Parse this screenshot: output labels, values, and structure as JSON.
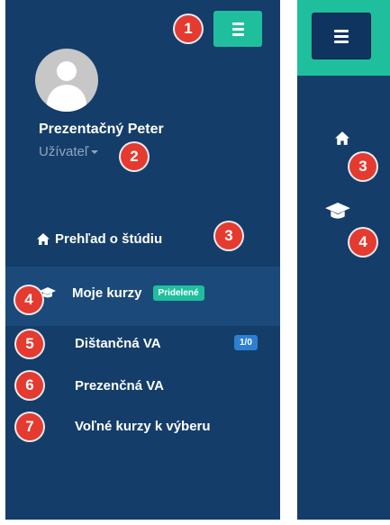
{
  "colors": {
    "sidebar": "#143d69",
    "accent_green": "#1fbf9e",
    "badge_red": "#e53a2f",
    "label_blue": "#2d7fd1"
  },
  "left_panel": {
    "menu_button_icon": "hamburger-icon",
    "user": {
      "name": "Prezentačný Peter",
      "role": "Užívateľ"
    },
    "nav": {
      "overview": {
        "icon": "home-icon",
        "label": "Prehľad o štúdiu"
      },
      "courses": {
        "icon": "graduation-cap-icon",
        "label": "Moje kurzy",
        "badge": "Pridelené"
      }
    },
    "sub_items": [
      {
        "label": "Dištančná VA",
        "badge": "1/0"
      },
      {
        "label": "Prezenčná VA"
      },
      {
        "label": "Voľné kurzy k výberu"
      }
    ]
  },
  "right_panel": {
    "menu_button_icon": "hamburger-icon",
    "icons": [
      "home-icon",
      "graduation-cap-icon"
    ]
  },
  "annotations": {
    "n1": "1",
    "n2": "2",
    "n3": "3",
    "n4": "4",
    "n5": "5",
    "n6": "6",
    "n7": "7",
    "r3": "3",
    "r4": "4"
  }
}
